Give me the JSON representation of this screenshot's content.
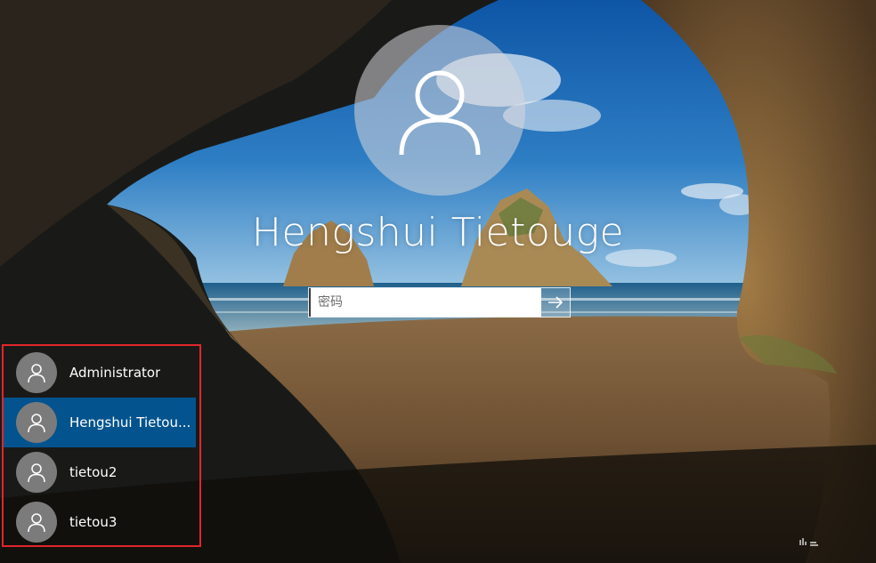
{
  "login": {
    "username": "Hengshui Tietouge",
    "password_placeholder": "密码"
  },
  "user_list": {
    "users": [
      {
        "name": "Administrator",
        "selected": false
      },
      {
        "name": "Hengshui Tietou...",
        "selected": true
      },
      {
        "name": "tietou2",
        "selected": false
      },
      {
        "name": "tietou3",
        "selected": false
      }
    ]
  },
  "icons": {
    "avatar": "user-silhouette-icon",
    "submit": "arrow-right-icon"
  },
  "colors": {
    "selected_user_bg": "#005b9e",
    "highlight_frame": "#e1262b",
    "avatar_circle": "#7b7b7b"
  }
}
